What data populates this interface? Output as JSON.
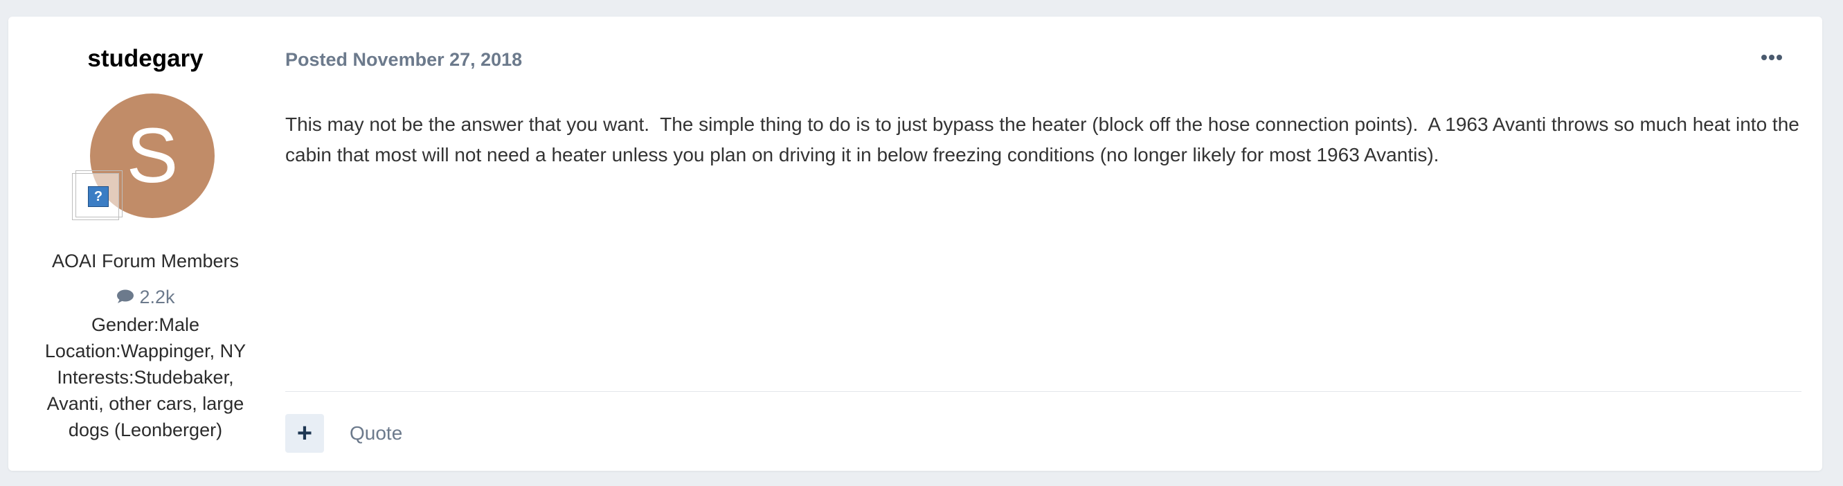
{
  "post": {
    "author": {
      "name": "studegary",
      "avatar_letter": "S",
      "avatar_color": "#c18c68",
      "rank_icon": "question-mark-icon",
      "rank_icon_glyph": "?",
      "group": "AOAI Forum Members",
      "post_count": "2.2k",
      "fields": [
        "Gender:Male",
        "Location:Wappinger, NY",
        "Interests:Studebaker, Avanti, other cars, large dogs (Leonberger)"
      ]
    },
    "meta": {
      "posted_label": "Posted",
      "date": "November 27, 2018"
    },
    "content": "This may not be the answer that you want.  The simple thing to do is to just bypass the heater (block off the hose connection points).  A 1963 Avanti throws so much heat into the cabin that most will not need a heater unless you plan on driving it in below freezing conditions (no longer likely for most 1963 Avantis).",
    "actions": {
      "reputation_glyph": "+",
      "quote_label": "Quote"
    }
  },
  "colors": {
    "page_background": "#ebeef2",
    "meta_text": "#6c7a8c",
    "rep_button_bg": "#e8eef5"
  }
}
